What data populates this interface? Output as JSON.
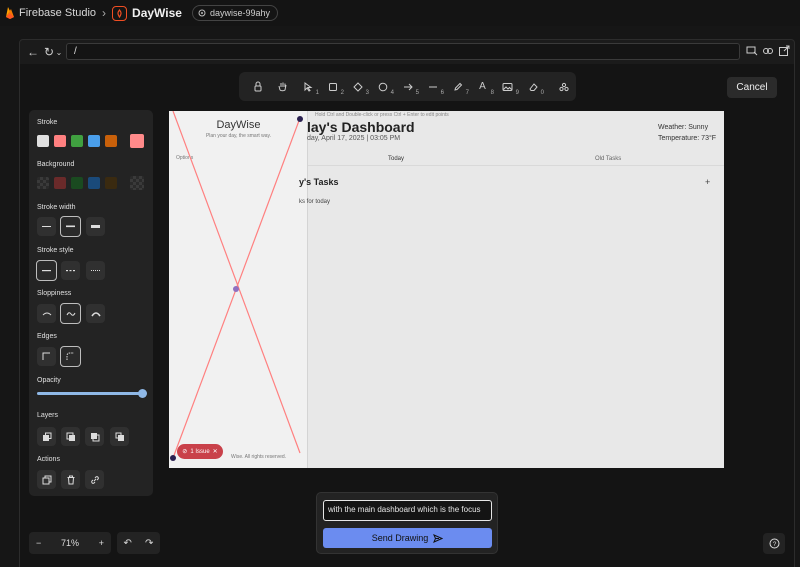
{
  "app": {
    "studio_name": "Firebase Studio",
    "project_name": "DayWise",
    "workspace_chip": "daywise-99ahy"
  },
  "browser": {
    "url": "/"
  },
  "toolbar": {
    "tools": [
      {
        "icon": "lock-icon",
        "num": ""
      },
      {
        "icon": "hand-icon",
        "num": ""
      },
      {
        "icon": "select-arrow-icon",
        "num": "1"
      },
      {
        "icon": "rectangle-icon",
        "num": "2"
      },
      {
        "icon": "diamond-icon",
        "num": "3"
      },
      {
        "icon": "ellipse-icon",
        "num": "4"
      },
      {
        "icon": "arrow-icon",
        "num": "5"
      },
      {
        "icon": "line-icon",
        "num": "6"
      },
      {
        "icon": "pencil-icon",
        "num": "7"
      },
      {
        "icon": "text-icon",
        "num": "8"
      },
      {
        "icon": "image-icon",
        "num": "9"
      },
      {
        "icon": "eraser-icon",
        "num": "0"
      },
      {
        "icon": "shapes-library-icon",
        "num": ""
      }
    ],
    "cancel_label": "Cancel"
  },
  "panel": {
    "stroke_label": "Stroke",
    "stroke_colors": [
      "#e0e0e0",
      "#ff8080",
      "#40a040",
      "#4a9eea",
      "#c8600a"
    ],
    "stroke_current": "#ff8a8a",
    "background_label": "Background",
    "background_colors": [
      "transparent",
      "#6a2a2a",
      "#1a4a20",
      "#1a4a7a",
      "#3a2a10"
    ],
    "stroke_width_label": "Stroke width",
    "stroke_style_label": "Stroke style",
    "sloppiness_label": "Sloppiness",
    "edges_label": "Edges",
    "opacity_label": "Opacity",
    "opacity_value": 100,
    "layers_label": "Layers",
    "actions_label": "Actions"
  },
  "preview": {
    "hint": "Hold Ctrl and Double-click or press Ctrl + Enter to edit points",
    "brand": "DayWise",
    "tagline": "Plan your day, the smart way.",
    "options_label": "Options",
    "title": "lay's Dashboard",
    "date": "day, April 17, 2025 | 03:05 PM",
    "weather": "Weather: Sunny",
    "temperature": "Temperature: 73°F",
    "tab_today": "Today",
    "tab_old": "Old Tasks",
    "tasks_heading": "y's Tasks",
    "no_tasks": "ks for today",
    "footer": "Wise. All rights reserved.",
    "issue_badge": "1 Issue"
  },
  "prompt": {
    "input_value": "with the main dashboard which is the focus",
    "send_label": "Send Drawing"
  },
  "zoom": {
    "level": "71%"
  },
  "colors": {
    "accent": "#6b8cf0",
    "drawing_stroke": "#ff8a8a",
    "issue": "#c9414a"
  }
}
